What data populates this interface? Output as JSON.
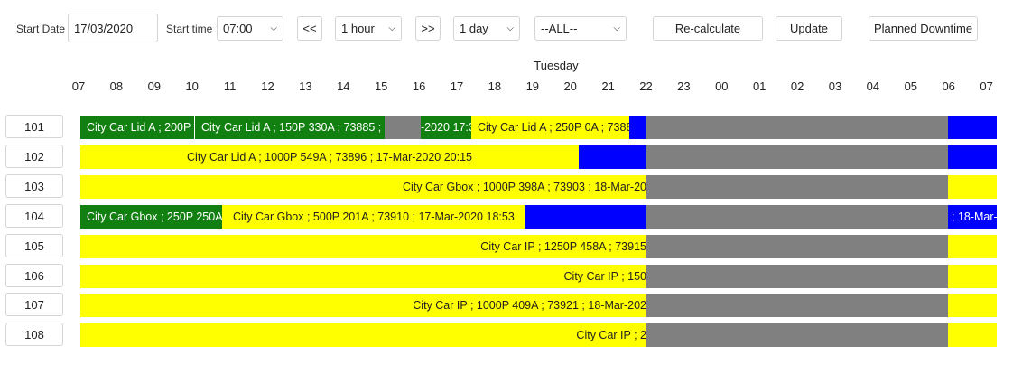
{
  "controls": {
    "start_date_label": "Start Date",
    "start_date_value": "17/03/2020",
    "start_time_label": "Start time",
    "start_time_value": "07:00",
    "prev_label": "<<",
    "interval_value": "1 hour",
    "next_label": ">>",
    "range_value": "1 day",
    "filter_value": "--ALL--",
    "recalculate_label": "Re-calculate",
    "update_label": "Update",
    "planned_downtime_label": "Planned Downtime"
  },
  "timeline": {
    "day_label": "Tuesday",
    "hours": [
      "07",
      "08",
      "09",
      "10",
      "11",
      "12",
      "13",
      "14",
      "15",
      "16",
      "17",
      "18",
      "19",
      "20",
      "21",
      "22",
      "23",
      "00",
      "01",
      "02",
      "03",
      "04",
      "05",
      "06",
      "07"
    ]
  },
  "colors": {
    "green": "#118011",
    "yellow": "#ffff00",
    "blue": "#0000ff",
    "grey": "#808080"
  },
  "rows": [
    {
      "id": "101",
      "segments": [
        {
          "color": "green",
          "text": "City Car Lid A ; 200P ;"
        },
        {
          "color": "green",
          "text": "City Car Lid A ; 150P 330A ; 73885 ;"
        },
        {
          "color": "grey",
          "text": ""
        },
        {
          "color": "green",
          "text": "-2020 17:3"
        },
        {
          "color": "yellow",
          "text": "City Car Lid A ; 250P 0A ; 7388"
        },
        {
          "color": "blue",
          "text": ""
        },
        {
          "color": "grey",
          "text": ""
        },
        {
          "color": "blue",
          "text": ""
        }
      ]
    },
    {
      "id": "102",
      "segments": [
        {
          "color": "yellow",
          "text": "City Car Lid A ; 1000P 549A ; 73896 ; 17-Mar-2020 20:15"
        },
        {
          "color": "blue",
          "text": ""
        },
        {
          "color": "grey",
          "text": ""
        },
        {
          "color": "blue",
          "text": ""
        }
      ]
    },
    {
      "id": "103",
      "segments": [
        {
          "color": "yellow",
          "text": "City Car Gbox ; 1000P 398A ; 73903 ; 18-Mar-20"
        },
        {
          "color": "grey",
          "text": ""
        },
        {
          "color": "yellow",
          "text": ""
        }
      ]
    },
    {
      "id": "104",
      "segments": [
        {
          "color": "green",
          "text": "City Car Gbox ; 250P 250A"
        },
        {
          "color": "yellow",
          "text": "City Car Gbox ; 500P 201A ; 73910 ; 17-Mar-2020 18:53"
        },
        {
          "color": "blue",
          "text": ""
        },
        {
          "color": "grey",
          "text": ""
        },
        {
          "color": "blue",
          "text": "; 18-Mar-"
        }
      ]
    },
    {
      "id": "105",
      "segments": [
        {
          "color": "yellow",
          "text": "City Car IP ; 1250P 458A ; 73915"
        },
        {
          "color": "grey",
          "text": ""
        },
        {
          "color": "yellow",
          "text": ""
        }
      ]
    },
    {
      "id": "106",
      "segments": [
        {
          "color": "yellow",
          "text": "City Car IP ; 150"
        },
        {
          "color": "grey",
          "text": ""
        },
        {
          "color": "yellow",
          "text": ""
        }
      ]
    },
    {
      "id": "107",
      "segments": [
        {
          "color": "yellow",
          "text": "City Car IP ; 1000P 409A ; 73921 ; 18-Mar-202"
        },
        {
          "color": "grey",
          "text": ""
        },
        {
          "color": "yellow",
          "text": ""
        }
      ]
    },
    {
      "id": "108",
      "segments": [
        {
          "color": "yellow",
          "text": "City Car IP ; 2"
        },
        {
          "color": "grey",
          "text": ""
        },
        {
          "color": "yellow",
          "text": ""
        }
      ]
    }
  ]
}
